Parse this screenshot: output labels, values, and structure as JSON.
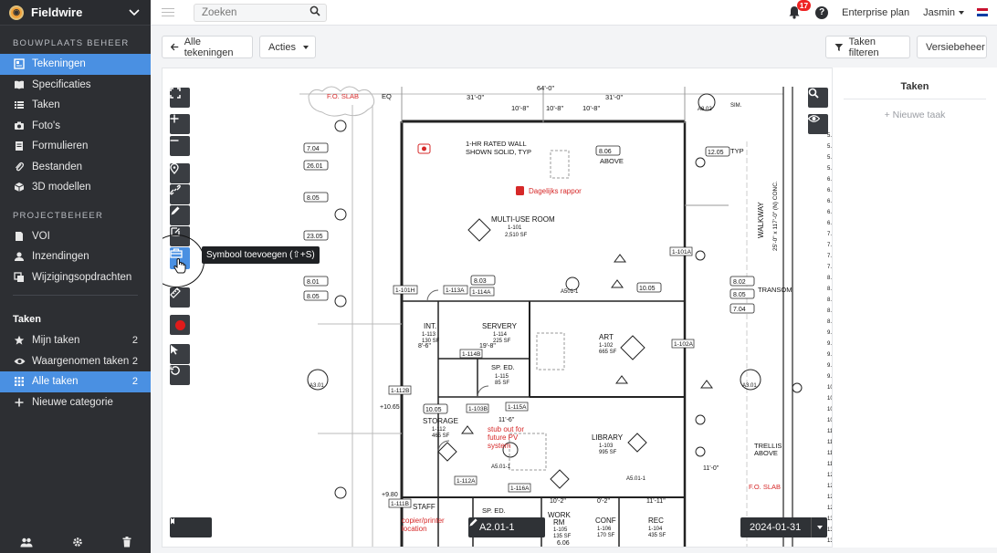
{
  "app": {
    "brand": "Fieldwire"
  },
  "sidebar": {
    "section_site": "BOUWPLAATS BEHEER",
    "site_items": [
      {
        "label": "Tekeningen",
        "icon": "drawings-icon"
      },
      {
        "label": "Specificaties",
        "icon": "book-icon"
      },
      {
        "label": "Taken",
        "icon": "list-icon"
      },
      {
        "label": "Foto's",
        "icon": "camera-icon"
      },
      {
        "label": "Formulieren",
        "icon": "forms-icon"
      },
      {
        "label": "Bestanden",
        "icon": "paperclip-icon"
      },
      {
        "label": "3D modellen",
        "icon": "cube-icon"
      }
    ],
    "section_project": "PROJECTBEHEER",
    "project_items": [
      {
        "label": "VOI",
        "icon": "document-icon"
      },
      {
        "label": "Inzendingen",
        "icon": "user-icon"
      },
      {
        "label": "Wijzigingsopdrachten",
        "icon": "copy-icon"
      }
    ],
    "section_tasks": "Taken",
    "task_items": [
      {
        "label": "Mijn taken",
        "count": "2",
        "icon": "star-icon"
      },
      {
        "label": "Waargenomen taken",
        "count": "2",
        "icon": "eye-icon"
      },
      {
        "label": "Alle taken",
        "count": "2",
        "icon": "grid-icon"
      },
      {
        "label": "Nieuwe categorie",
        "icon": "plus-icon"
      }
    ]
  },
  "topbar": {
    "search_placeholder": "Zoeken",
    "notification_count": "17",
    "plan_label": "Enterprise plan",
    "user_name": "Jasmin"
  },
  "toolbar": {
    "back_label": "Alle tekeningen",
    "actions_label": "Acties",
    "filter_label": "Taken filteren",
    "version_label": "Versiebeheer"
  },
  "drawing": {
    "tooltip": "Symbool toevoegen (⇧+S)",
    "sheet_name": "A2.01-1",
    "date": "2024-01-31",
    "labels": {
      "slab_top": "F.O. SLAB",
      "eq": "EQ",
      "dim_64": "64'-0\"",
      "dim_31a": "31'-0\"",
      "dim_31b": "31'-0\"",
      "dim_10_8a": "10'-8\"",
      "dim_10_8b": "10'-8\"",
      "dim_10_8c": "10'-8\"",
      "rated_wall": "1-HR RATED WALL",
      "shown_solid": "SHOWN SOLID, TYP",
      "rapport": "Dagelijks rappor",
      "room_multi": "MULTI-USE ROOM",
      "room_multi_no": "1-101",
      "room_multi_sf": "2,510 SF",
      "walkway": "WALKWAY",
      "walkway_dim": "25'-0\" x 117'-0\" (N) CONC.",
      "above": "ABOVE",
      "typ": "TYP",
      "room_int": "INT.",
      "room_int_no": "1-113",
      "room_int_sf": "130 SF",
      "room_servery": "SERVERY",
      "room_servery_no": "1-114",
      "room_servery_sf": "225 SF",
      "room_art": "ART",
      "room_art_no": "1-102",
      "room_art_sf": "665 SF",
      "room_sped": "SP. ED.",
      "room_sped_no": "1-115",
      "room_sped_sf": "85 SF",
      "room_storage": "STORAGE",
      "room_storage_no": "1-112",
      "room_storage_sf": "465 SF",
      "stub": "stub out for",
      "future_pv": "future PV",
      "system": "system",
      "room_library": "LIBRARY",
      "room_library_no": "1-103",
      "room_library_sf": "995 SF",
      "trellis": "TRELLIS",
      "fo_slab": "F.O. SLAB",
      "room_work": "WORK",
      "room_work2": "RM",
      "room_work_no": "1-105",
      "room_work_sf": "135 SF",
      "room_conf": "CONF",
      "room_conf_no": "1-106",
      "room_conf_sf": "170 SF",
      "room_rec": "REC",
      "room_rec_no": "1-104",
      "room_rec_sf": "435 SF",
      "room_staff": "STAFF",
      "copier": "copier/printer",
      "location": "location",
      "sp_ed2": "SP. ED.",
      "transom": "TRANSOM",
      "sim": "SIM.",
      "tag_704a": "7.04",
      "tag_2601": "26.01",
      "tag_805a": "8.05",
      "tag_2305": "23.05",
      "tag_801": "8.01",
      "tag_805b": "8.05",
      "tag_806": "8.06",
      "tag_1205": "12.05",
      "tag_803": "8.03",
      "tag_1005a": "10.05",
      "tag_802": "8.02",
      "tag_805c": "8.05",
      "tag_704b": "7.04",
      "tag_1005b": "10.05",
      "tag_1065": "+10.65",
      "tag_980": "+9.80",
      "tag_606": "6.06",
      "tag_a501": "A501-1",
      "tag_a301a": "A3.01",
      "tag_a301b": "A3.01",
      "tag_a501b": "A5.01-1",
      "tag_a501c": "A5.01-1",
      "tag_a802": "A8.02",
      "door_101h": "1-101H",
      "door_113a": "1-113A",
      "door_114a": "1-114A",
      "door_101j": "1-101J",
      "door_101a": "1-101A",
      "door_114b": "1-114B",
      "door_112b": "1-112B",
      "door_103b": "1-103B",
      "door_115a": "1-115A",
      "door_102a": "1-102A",
      "door_112a": "1-112A",
      "door_116a": "1-116A",
      "door_111b": "1-111B",
      "dim_19_8": "19'-8\"",
      "dim_11_6": "11'-6\"",
      "dim_10_2": "10'-2\"",
      "dim_0_2": "0'-2\"",
      "dim_11_11": "11'-11\"",
      "dim_11_0": "11'-0\"",
      "dim_8_6": "8'-6\""
    }
  },
  "right_panel": {
    "title": "Taken",
    "new_task": "+ Nieuwe taak"
  },
  "colors": {
    "accent": "#4a90e2",
    "sidebar_bg": "#2d2f33",
    "drawing_red": "#d62828"
  }
}
